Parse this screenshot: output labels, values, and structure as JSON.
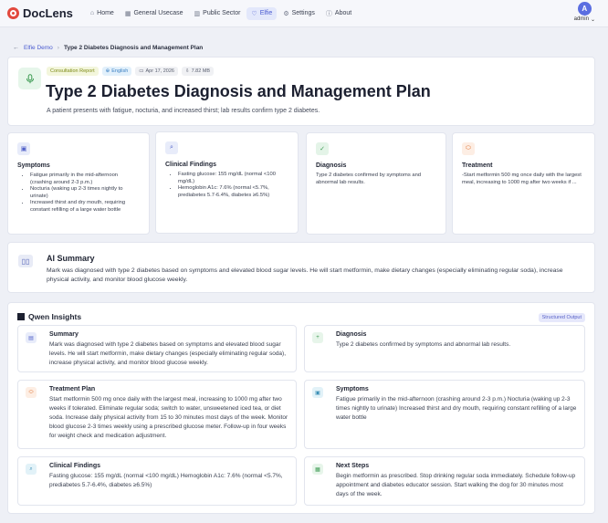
{
  "nav": {
    "brand": "DocLens",
    "items": [
      {
        "label": "Home",
        "icon": "home-icon"
      },
      {
        "label": "General Usecase",
        "icon": "grid-icon"
      },
      {
        "label": "Public Sector",
        "icon": "building-icon"
      },
      {
        "label": "Elfie",
        "icon": "heart-icon"
      },
      {
        "label": "Settings",
        "icon": "gear-icon"
      },
      {
        "label": "About",
        "icon": "info-icon"
      }
    ],
    "active": "Elfie",
    "user": {
      "initial": "A",
      "name": "admin"
    }
  },
  "breadcrumb": {
    "parent": "Elfie Demo",
    "current": "Type 2 Diabetes Diagnosis and Management Plan"
  },
  "header": {
    "tags": {
      "report": "Consultation Report",
      "language": "English",
      "date": "Apr 17, 2026",
      "size": "7.82 MB"
    },
    "title": "Type 2 Diabetes Diagnosis and Management Plan",
    "subtitle": "A patient presents with fatigue, nocturia, and increased thirst; lab results confirm type 2 diabetes."
  },
  "cards": {
    "symptoms": {
      "title": "Symptoms",
      "items": [
        "Fatigue primarily in the mid-afternoon (crashing around 2-3 p.m.)",
        "Nocturia (waking up 2-3 times nightly to urinate)",
        "Increased thirst and dry mouth, requiring constant refilling of a large water bottle"
      ]
    },
    "findings": {
      "title": "Clinical Findings",
      "items": [
        "Fasting glucose: 155 mg/dL (normal <100 mg/dL)",
        "Hemoglobin A1c: 7.6% (normal <5.7%, prediabetes 5.7-6.4%, diabetes ≥6.5%)"
      ]
    },
    "diagnosis": {
      "title": "Diagnosis",
      "text": "Type 2 diabetes confirmed by symptoms and abnormal lab results."
    },
    "treatment": {
      "title": "Treatment",
      "text": "-Start metformin 500 mg once daily with the largest meal, increasing to 1000 mg after two weeks if ..."
    }
  },
  "ai_summary": {
    "title": "AI Summary",
    "text": "Mark was diagnosed with type 2 diabetes based on symptoms and elevated blood sugar levels. He will start metformin, make dietary changes (especially eliminating regular soda), increase physical activity, and monitor blood glucose weekly."
  },
  "qwen": {
    "title": "Qwen Insights",
    "badge": "Structured Output",
    "summary": {
      "title": "Summary",
      "text": "Mark was diagnosed with type 2 diabetes based on symptoms and elevated blood sugar levels. He will start metformin, make dietary changes (especially eliminating regular soda), increase physical activity, and monitor blood glucose weekly."
    },
    "diagnosis": {
      "title": "Diagnosis",
      "text": "Type 2 diabetes confirmed by symptoms and abnormal lab results."
    },
    "treatment": {
      "title": "Treatment Plan",
      "text": "Start metformin 500 mg once daily with the largest meal, increasing to 1000 mg after two weeks if tolerated. Eliminate regular soda; switch to water, unsweetened iced tea, or diet soda. Increase daily physical activity from 15 to 30 minutes most days of the week. Monitor blood glucose 2-3 times weekly using a prescribed glucose meter. Follow-up in four weeks for weight check and medication adjustment."
    },
    "symptoms": {
      "title": "Symptoms",
      "text": "Fatigue primarily in the mid-afternoon (crashing around 2-3 p.m.) Nocturia (waking up 2-3 times nightly to urinate) Increased thirst and dry mouth, requiring constant refilling of a large water bottle"
    },
    "findings": {
      "title": "Clinical Findings",
      "text": "Fasting glucose: 155 mg/dL (normal <100 mg/dL) Hemoglobin A1c: 7.6% (normal <5.7%, prediabetes 5.7-6.4%, diabetes ≥6.5%)"
    },
    "next_steps": {
      "title": "Next Steps",
      "text": "Begin metformin as prescribed. Stop drinking regular soda immediately. Schedule follow-up appointment and diabetes educator session. Start walking the dog for 30 minutes most days of the week."
    }
  }
}
